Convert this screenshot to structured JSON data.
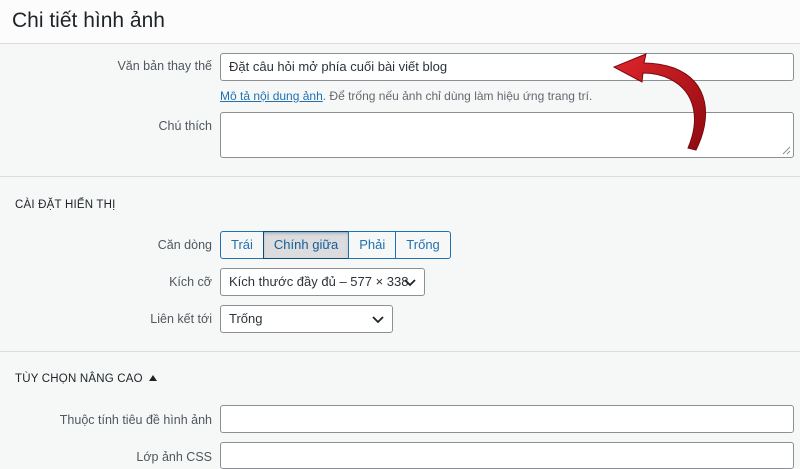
{
  "header": {
    "title": "Chi tiết hình ảnh"
  },
  "alt_text": {
    "label": "Văn bản thay thế",
    "value": "Đặt câu hỏi mở phía cuối bài viết blog",
    "help_link": "Mô tả nội dung ảnh",
    "help_text": ". Để trống nếu ảnh chỉ dùng làm hiệu ứng trang trí."
  },
  "caption": {
    "label": "Chú thích",
    "value": ""
  },
  "display_settings": {
    "title": "CÀI ĐẶT HIỂN THỊ",
    "align": {
      "label": "Căn dòng",
      "options": [
        "Trái",
        "Chính giữa",
        "Phải",
        "Trống"
      ],
      "selected": "Chính giữa"
    },
    "size": {
      "label": "Kích cỡ",
      "value": "Kích thước đầy đủ – 577 × 338"
    },
    "link_to": {
      "label": "Liên kết tới",
      "value": "Trống"
    }
  },
  "advanced": {
    "title": "TÙY CHỌN NÂNG CAO",
    "title_attr": {
      "label": "Thuộc tính tiêu đề hình ảnh",
      "value": ""
    },
    "css_class": {
      "label": "Lớp ảnh CSS",
      "value": ""
    }
  },
  "colors": {
    "accent": "#2271b1",
    "arrow": "#c0141c"
  }
}
